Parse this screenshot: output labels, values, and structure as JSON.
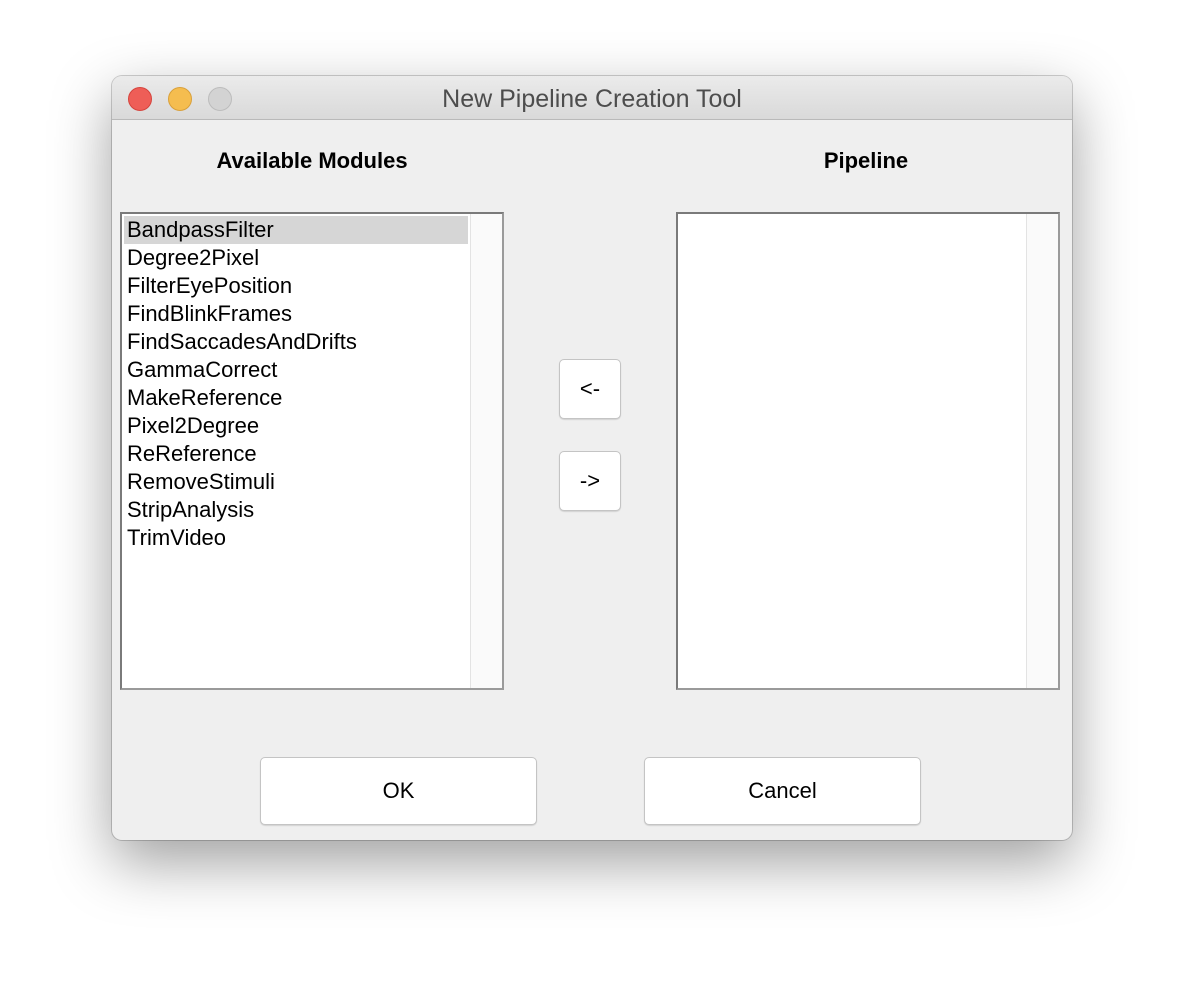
{
  "window": {
    "title": "New Pipeline Creation Tool"
  },
  "available": {
    "heading": "Available Modules",
    "selected_index": 0,
    "items": [
      "BandpassFilter",
      "Degree2Pixel",
      "FilterEyePosition",
      "FindBlinkFrames",
      "FindSaccadesAndDrifts",
      "GammaCorrect",
      "MakeReference",
      "Pixel2Degree",
      "ReReference",
      "RemoveStimuli",
      "StripAnalysis",
      "TrimVideo"
    ]
  },
  "pipeline": {
    "heading": "Pipeline",
    "items": []
  },
  "buttons": {
    "remove_label": "<-",
    "add_label": "->",
    "ok_label": "OK",
    "cancel_label": "Cancel"
  },
  "colors": {
    "close": "#ee5e57",
    "minimize": "#f5bd4f",
    "zoom": "#d3d3d3",
    "selection": "#d6d6d6"
  }
}
